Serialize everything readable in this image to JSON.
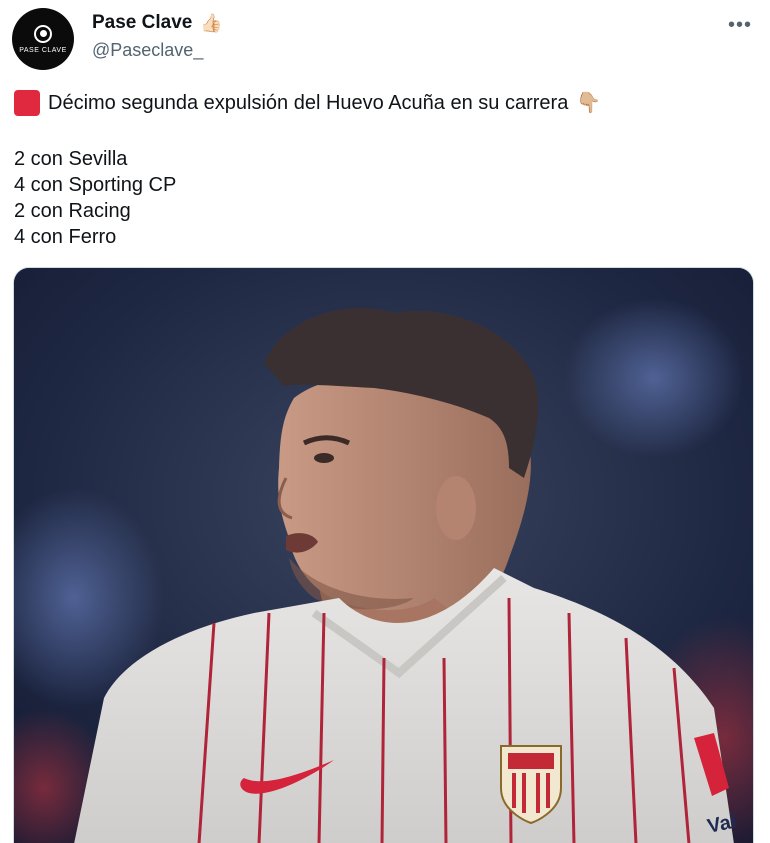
{
  "tweet": {
    "author": {
      "display_name": "Pase Clave",
      "handle": "@Paseclave_",
      "avatar_text": "PASE CLAVE",
      "name_emoji": "👍🏻"
    },
    "more_label": "•••",
    "headline": "Décimo segunda expulsión del Huevo Acuña en su carrera",
    "headline_emoji_end": "👇🏼",
    "lines": [
      "2 con Sevilla",
      "4 con Sporting CP",
      "2 con Racing",
      "4 con Ferro"
    ],
    "media": {
      "kit_sponsor_text": "Val"
    }
  },
  "colors": {
    "red_card": "#e0283e",
    "handle_gray": "#536471",
    "text": "#0f1419"
  }
}
